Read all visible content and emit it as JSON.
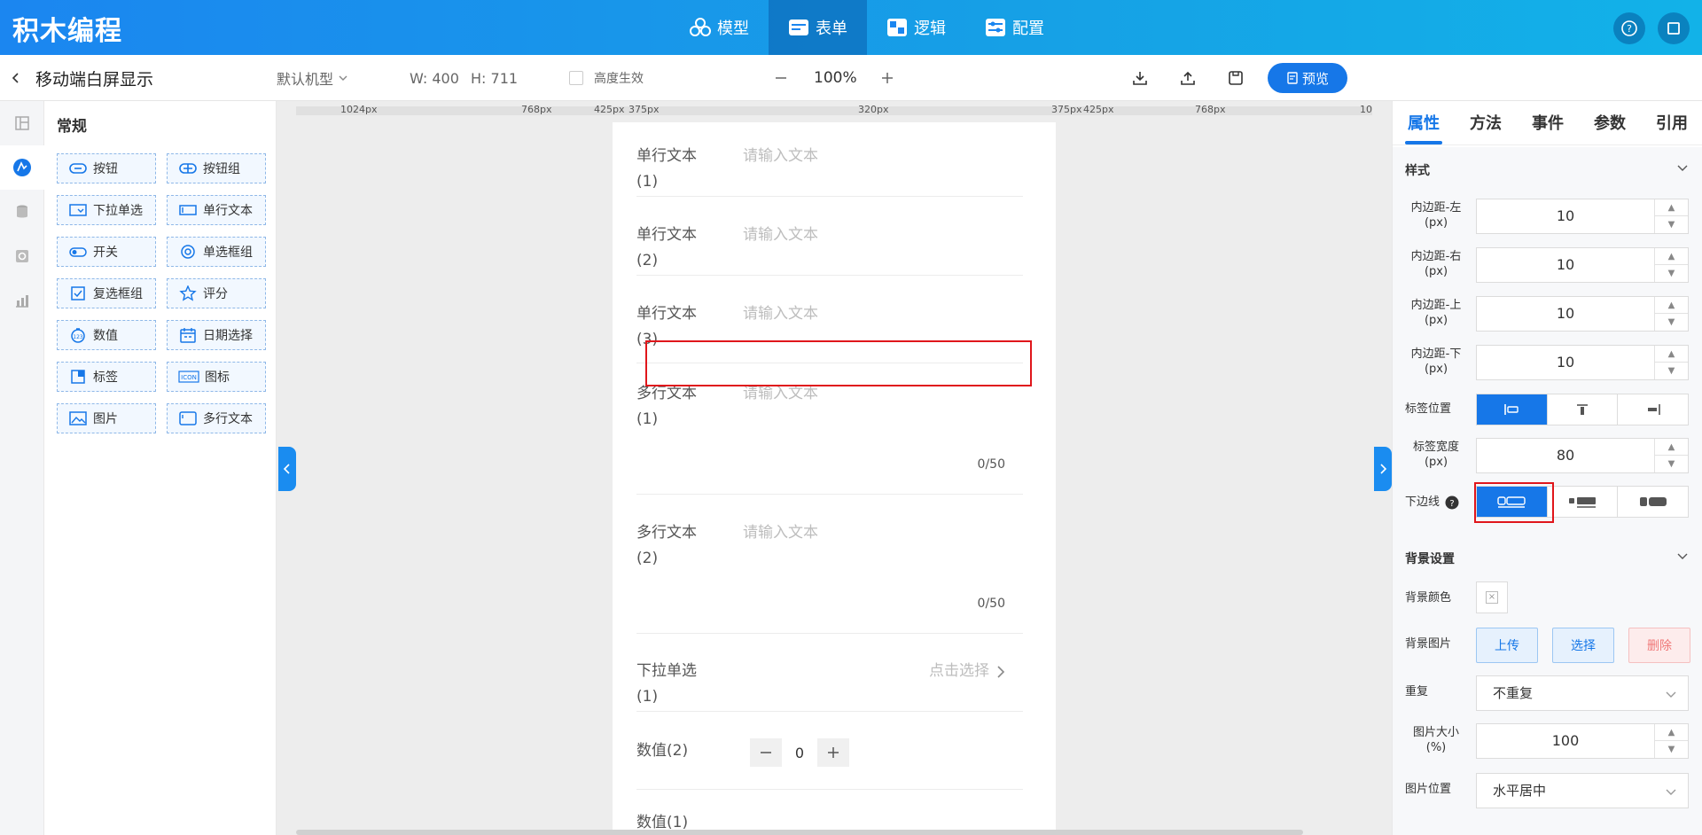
{
  "app": {
    "brand": "积木编程"
  },
  "topnav": [
    {
      "key": "model",
      "label": "模型",
      "icon": "cubes-icon"
    },
    {
      "key": "form",
      "label": "表单",
      "icon": "form-icon",
      "active": true
    },
    {
      "key": "logic",
      "label": "逻辑",
      "icon": "logic-icon"
    },
    {
      "key": "config",
      "label": "配置",
      "icon": "config-icon"
    }
  ],
  "toolbar": {
    "page_title": "移动端白屏显示",
    "device": "默认机型",
    "width_text": "W: 400",
    "height_text": "H: 711",
    "height_effect_label": "高度生效",
    "zoom": "100%",
    "preview_label": "预览"
  },
  "left_panel": {
    "title": "常规",
    "components": [
      {
        "label": "按钮",
        "icon": "button-icon"
      },
      {
        "label": "按钮组",
        "icon": "button-group-icon"
      },
      {
        "label": "下拉单选",
        "icon": "dropdown-icon"
      },
      {
        "label": "单行文本",
        "icon": "text-input-icon"
      },
      {
        "label": "开关",
        "icon": "switch-icon"
      },
      {
        "label": "单选框组",
        "icon": "radio-icon"
      },
      {
        "label": "复选框组",
        "icon": "checkbox-icon"
      },
      {
        "label": "评分",
        "icon": "star-icon"
      },
      {
        "label": "数值",
        "icon": "number-icon"
      },
      {
        "label": "日期选择",
        "icon": "calendar-icon"
      },
      {
        "label": "标签",
        "icon": "label-icon"
      },
      {
        "label": "图标",
        "icon": "icon-icon"
      },
      {
        "label": "图片",
        "icon": "image-icon"
      },
      {
        "label": "多行文本",
        "icon": "textarea-icon"
      }
    ]
  },
  "ruler": [
    "1024px",
    "768px",
    "425px",
    "375px",
    "320px",
    "375px",
    "425px",
    "768px",
    "10"
  ],
  "form": {
    "placeholder": "请输入文本",
    "select_placeholder": "点击选择",
    "fields": [
      {
        "label_line1": "单行文本",
        "label_line2": "(1)"
      },
      {
        "label_line1": "单行文本",
        "label_line2": "(2)"
      },
      {
        "label_line1": "单行文本",
        "label_line2": "(3)"
      },
      {
        "label_line1": "多行文本",
        "label_line2": "(1)",
        "count": "0/50"
      },
      {
        "label_line1": "多行文本",
        "label_line2": "(2)",
        "count": "0/50"
      },
      {
        "label_line1": "下拉单选",
        "label_line2": "(1)"
      },
      {
        "label": "数值(2)",
        "value": "0"
      },
      {
        "label": "数值(1)"
      }
    ]
  },
  "right_panel": {
    "tabs": [
      "属性",
      "方法",
      "事件",
      "参数",
      "引用"
    ],
    "style_section": "样式",
    "padding_left": {
      "label": "内边距-左(px)",
      "value": "10"
    },
    "padding_right": {
      "label": "内边距-右(px)",
      "value": "10"
    },
    "padding_top": {
      "label": "内边距-上(px)",
      "value": "10"
    },
    "padding_bottom": {
      "label": "内边距-下(px)",
      "value": "10"
    },
    "label_position": "标签位置",
    "label_width": {
      "label": "标签宽度(px)",
      "value": "80"
    },
    "bottom_line": "下边线",
    "bg_section": "背景设置",
    "bg_color": "背景颜色",
    "bg_image": "背景图片",
    "upload": "上传",
    "choose": "选择",
    "delete": "删除",
    "repeat": {
      "label": "重复",
      "value": "不重复"
    },
    "img_size": {
      "label": "图片大小(%)",
      "value": "100"
    },
    "img_pos": {
      "label": "图片位置",
      "value": "水平居中"
    }
  },
  "colors": {
    "accent": "#1677e8",
    "header": "#1b86f0",
    "danger": "#e0161b"
  }
}
